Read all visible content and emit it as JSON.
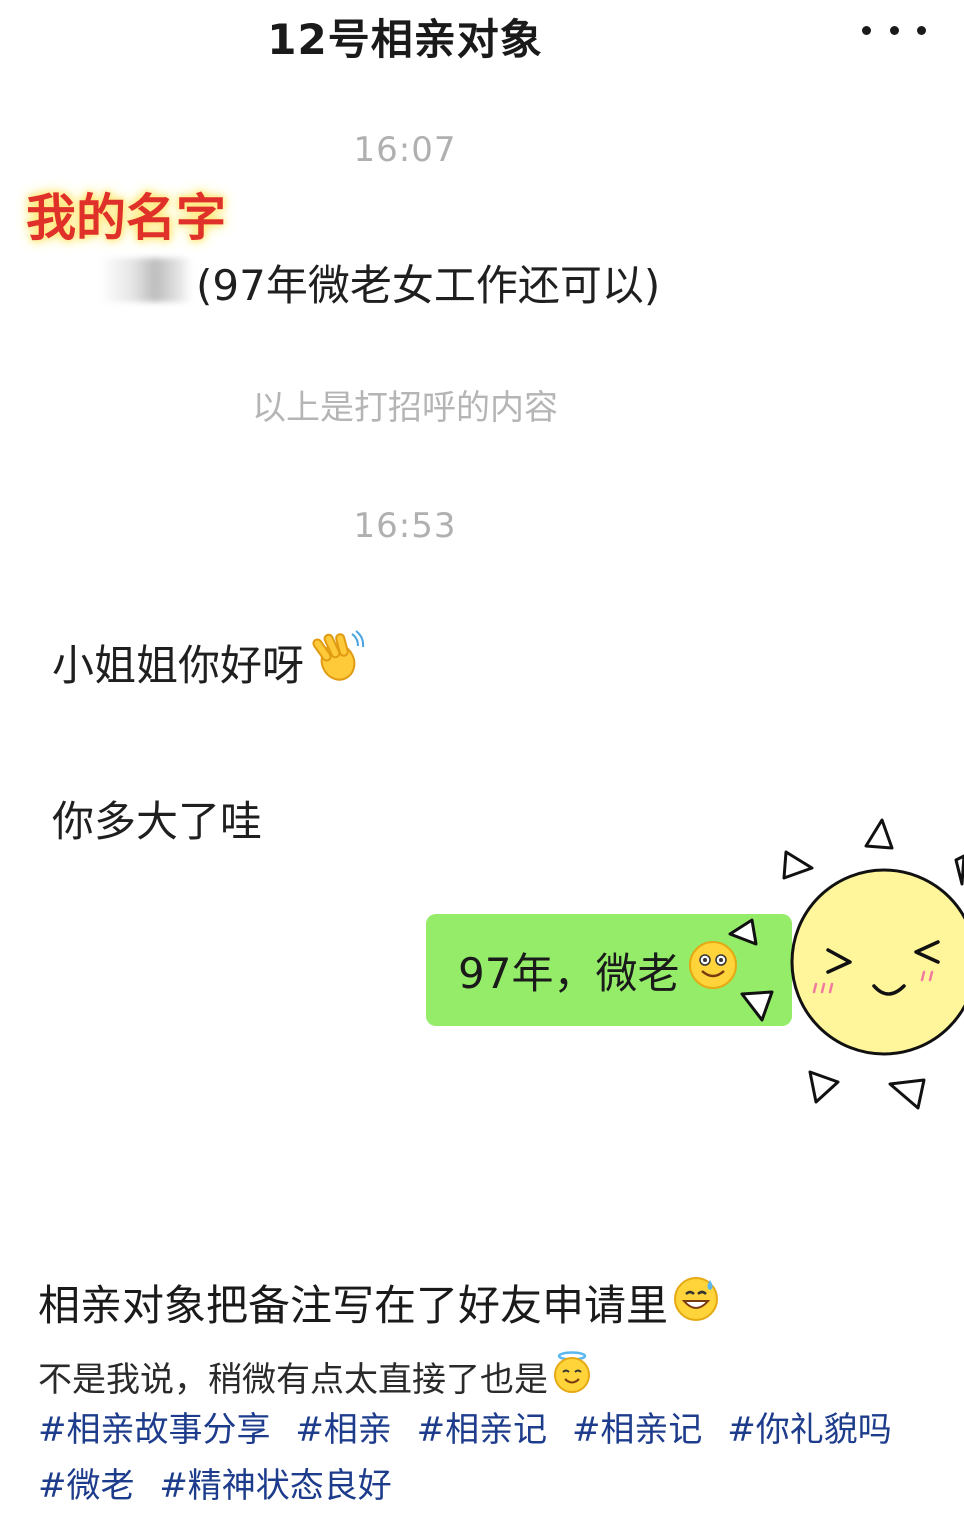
{
  "header": {
    "title": "12号相亲对象",
    "more_icon": "more-dots-icon"
  },
  "chat": {
    "time1": "16:07",
    "annotation": "我的名字",
    "greeting_text": "(97年微老女工作还可以)",
    "system_note": "以上是打招呼的内容",
    "time2": "16:53",
    "msg1": "小姐姐你好呀",
    "msg1_icon": "waving-hand-icon",
    "msg2": "你多大了哇",
    "reply": "97年，微老",
    "reply_icon": "smiling-face-icon",
    "bubble_color": "#95ec69"
  },
  "post": {
    "caption": "相亲对象把备注写在了好友申请里",
    "caption_icon": "grin-sweat-icon",
    "body": "不是我说，稍微有点太直接了也是",
    "body_icon": "halo-face-icon",
    "tags": [
      "#相亲故事分享",
      "#相亲",
      "#相亲记",
      "#相亲记",
      "#你礼貌吗",
      "#微老",
      "#精神状态良好"
    ],
    "tag_color": "#1e3c8c"
  },
  "decor": {
    "sticker": "sun-sticker-icon",
    "sticker_color": "#fff59a"
  }
}
